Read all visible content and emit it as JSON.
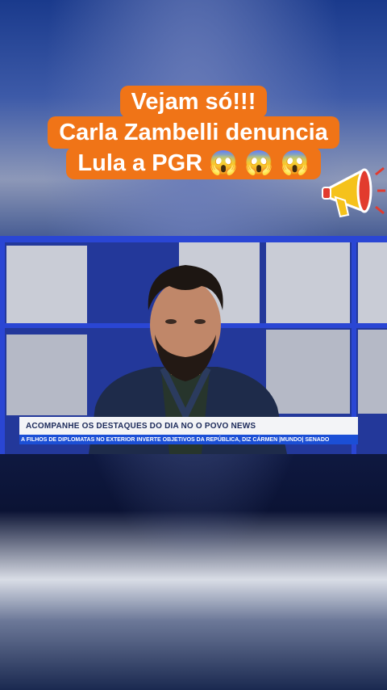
{
  "caption": {
    "lines": [
      "Vejam só!!!",
      "Carla Zambelli denuncia",
      "Lula a PGR 😱 😱 😱"
    ]
  },
  "video": {
    "lower_third": "ACOMPANHE OS DESTAQUES DO DIA NO O POVO NEWS",
    "ticker": "A FILHOS DE DIPLOMATAS NO EXTERIOR INVERTE OBJETIVOS DA REPÚBLICA, DIZ CÁRMEN   |MUNDO| SENADO"
  },
  "colors": {
    "caption_bg": "#f07417",
    "ticker_bg": "#1b4fd6",
    "studio_blue": "#2a46d4"
  }
}
